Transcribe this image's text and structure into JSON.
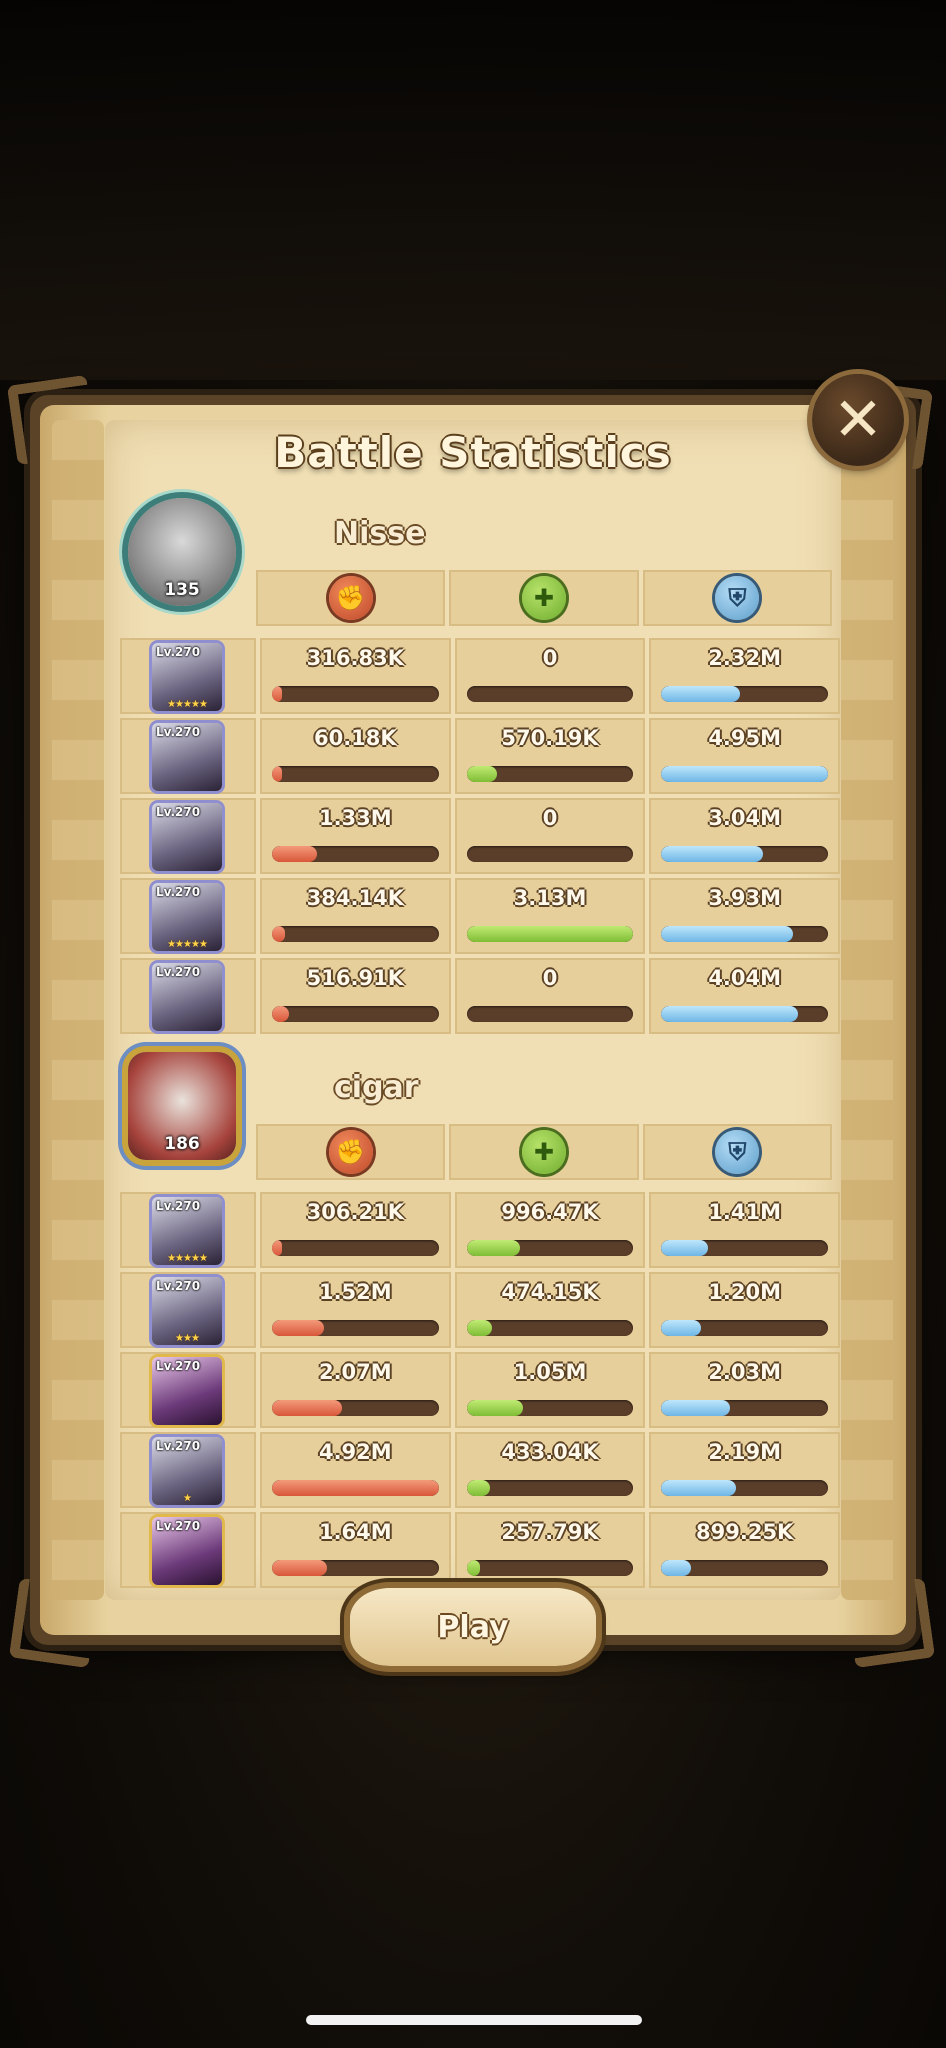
{
  "title": "Battle Statistics",
  "close_icon": "close-icon",
  "play_label": "Play",
  "stat_icons": {
    "damage": "damage-icon",
    "healing": "healing-icon",
    "defense": "shield-icon"
  },
  "colors": {
    "damage": "#d9573a",
    "healing": "#7fbd35",
    "defense": "#6fb6e6",
    "panel": "#f0dfb4"
  },
  "teams": [
    {
      "player_name": "Nisse",
      "player_level": "135",
      "heroes": [
        {
          "level": "Lv.270",
          "stars": "★★★★★",
          "damage": "316.83K",
          "healing": "0",
          "defense": "2.32M",
          "damage_fill": 0.03,
          "healing_fill": 0,
          "defense_fill": 0.47
        },
        {
          "level": "Lv.270",
          "stars": "",
          "damage": "60.18K",
          "healing": "570.19K",
          "defense": "4.95M",
          "damage_fill": 0.01,
          "healing_fill": 0.18,
          "defense_fill": 1.0
        },
        {
          "level": "Lv.270",
          "stars": "",
          "damage": "1.33M",
          "healing": "0",
          "defense": "3.04M",
          "damage_fill": 0.27,
          "healing_fill": 0,
          "defense_fill": 0.61
        },
        {
          "level": "Lv.270",
          "stars": "★★★★★",
          "damage": "384.14K",
          "healing": "3.13M",
          "defense": "3.93M",
          "damage_fill": 0.08,
          "healing_fill": 1.0,
          "defense_fill": 0.79
        },
        {
          "level": "Lv.270",
          "stars": "",
          "damage": "516.91K",
          "healing": "0",
          "defense": "4.04M",
          "damage_fill": 0.1,
          "healing_fill": 0,
          "defense_fill": 0.82
        }
      ]
    },
    {
      "player_name": "cigar",
      "player_level": "186",
      "heroes": [
        {
          "level": "Lv.270",
          "stars": "★★★★★",
          "damage": "306.21K",
          "healing": "996.47K",
          "defense": "1.41M",
          "damage_fill": 0.06,
          "healing_fill": 0.32,
          "defense_fill": 0.28
        },
        {
          "level": "Lv.270",
          "stars": "★★★",
          "damage": "1.52M",
          "healing": "474.15K",
          "defense": "1.20M",
          "damage_fill": 0.31,
          "healing_fill": 0.15,
          "defense_fill": 0.24
        },
        {
          "level": "Lv.270",
          "stars": "",
          "damage": "2.07M",
          "healing": "1.05M",
          "defense": "2.03M",
          "damage_fill": 0.42,
          "healing_fill": 0.34,
          "defense_fill": 0.41
        },
        {
          "level": "Lv.270",
          "stars": "★",
          "damage": "4.92M",
          "healing": "433.04K",
          "defense": "2.19M",
          "damage_fill": 1.0,
          "healing_fill": 0.14,
          "defense_fill": 0.45
        },
        {
          "level": "Lv.270",
          "stars": "",
          "damage": "1.64M",
          "healing": "257.79K",
          "defense": "899.25K",
          "damage_fill": 0.33,
          "healing_fill": 0.08,
          "defense_fill": 0.18
        }
      ]
    }
  ]
}
